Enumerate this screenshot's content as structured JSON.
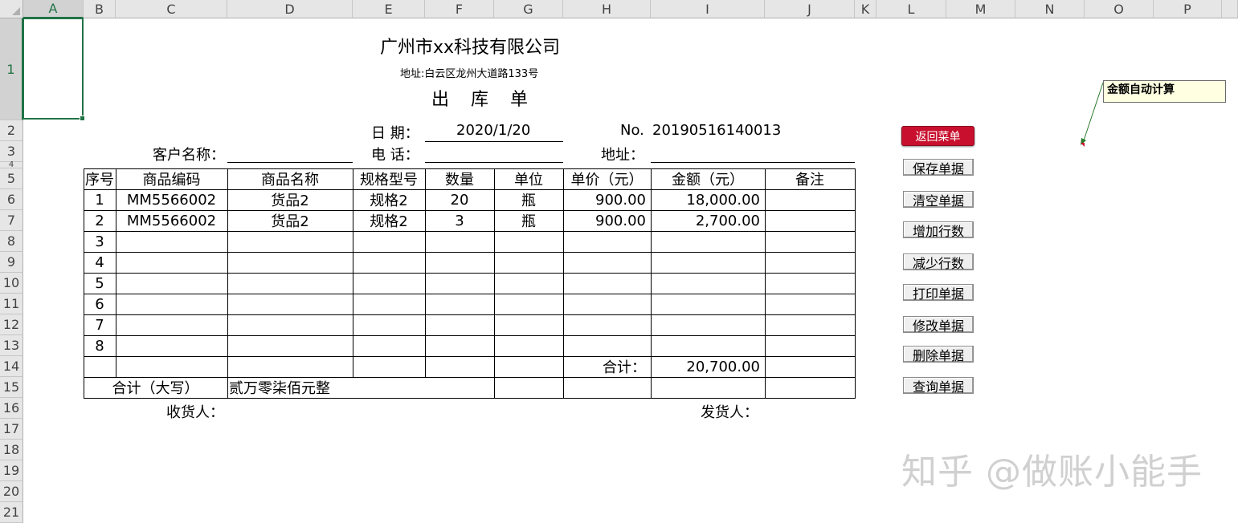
{
  "columns": [
    {
      "label": "A",
      "selected": true
    },
    {
      "label": "B"
    },
    {
      "label": "C"
    },
    {
      "label": "D"
    },
    {
      "label": "E"
    },
    {
      "label": "F"
    },
    {
      "label": "G"
    },
    {
      "label": "H"
    },
    {
      "label": "I"
    },
    {
      "label": "J"
    },
    {
      "label": "K"
    },
    {
      "label": "L"
    },
    {
      "label": "M"
    },
    {
      "label": "N"
    },
    {
      "label": "O"
    },
    {
      "label": "P"
    }
  ],
  "rows": [
    "1",
    "2",
    "3",
    "4",
    "5",
    "6",
    "7",
    "8",
    "9",
    "10",
    "11",
    "12",
    "13",
    "14",
    "15",
    "16",
    "17",
    "18",
    "19",
    "20",
    "21"
  ],
  "sheet": {
    "company": "广州市xx科技有限公司",
    "address": "地址:白云区龙州大道路133号",
    "bill_title": "出 库 单",
    "date_label": "日 期：",
    "date_value": "2020/1/20",
    "no_label": "No.",
    "no_value": "20190516140013",
    "customer_label": "客户名称：",
    "phone_label": "电 话：",
    "addr_label": "地址：",
    "table_headers": [
      "序号",
      "商品编码",
      "商品名称",
      "规格型号",
      "数量",
      "单位",
      "单价（元）",
      "金额（元）",
      "备注"
    ],
    "items": [
      {
        "seq": "1",
        "code": "MM5566002",
        "name": "货品2",
        "spec": "规格2",
        "qty": "20",
        "unit": "瓶",
        "price": "900.00",
        "amount": "18,000.00",
        "note": ""
      },
      {
        "seq": "2",
        "code": "MM5566002",
        "name": "货品2",
        "spec": "规格2",
        "qty": "3",
        "unit": "瓶",
        "price": "900.00",
        "amount": "2,700.00",
        "note": ""
      },
      {
        "seq": "3",
        "code": "",
        "name": "",
        "spec": "",
        "qty": "",
        "unit": "",
        "price": "",
        "amount": "",
        "note": ""
      },
      {
        "seq": "4",
        "code": "",
        "name": "",
        "spec": "",
        "qty": "",
        "unit": "",
        "price": "",
        "amount": "",
        "note": ""
      },
      {
        "seq": "5",
        "code": "",
        "name": "",
        "spec": "",
        "qty": "",
        "unit": "",
        "price": "",
        "amount": "",
        "note": ""
      },
      {
        "seq": "6",
        "code": "",
        "name": "",
        "spec": "",
        "qty": "",
        "unit": "",
        "price": "",
        "amount": "",
        "note": ""
      },
      {
        "seq": "7",
        "code": "",
        "name": "",
        "spec": "",
        "qty": "",
        "unit": "",
        "price": "",
        "amount": "",
        "note": ""
      },
      {
        "seq": "8",
        "code": "",
        "name": "",
        "spec": "",
        "qty": "",
        "unit": "",
        "price": "",
        "amount": "",
        "note": ""
      }
    ],
    "total_label": "合计：",
    "total_value": "20,700.00",
    "total_upper_label": "合计（大写）",
    "total_upper_value": "贰万零柒佰元整",
    "receiver_label": "收货人：",
    "shipper_label": "发货人："
  },
  "buttons": {
    "back": "返回菜单",
    "save": "保存单据",
    "clear": "清空单据",
    "add_row": "增加行数",
    "remove_row": "减少行数",
    "print": "打印单据",
    "edit": "修改单据",
    "delete": "删除单据",
    "query": "查询单据"
  },
  "comment": "金额自动计算",
  "watermark": "知乎 @做账小能手",
  "colors": {
    "accent": "#217346",
    "red_button": "#c8102e",
    "comment_bg": "#ffffe1"
  }
}
